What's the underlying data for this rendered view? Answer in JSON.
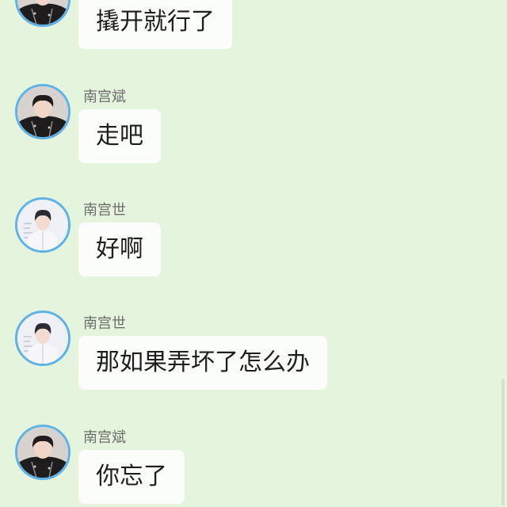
{
  "messages": [
    {
      "sender": "",
      "text": "撬开就行了",
      "avatar": "avatar-dark-jacket"
    },
    {
      "sender": "南宫斌",
      "text": "走吧",
      "avatar": "avatar-dark-jacket"
    },
    {
      "sender": "南宫世",
      "text": "好啊",
      "avatar": "avatar-white-suit"
    },
    {
      "sender": "南宫世",
      "text": "那如果弄坏了怎么办",
      "avatar": "avatar-white-suit"
    },
    {
      "sender": "南宫斌",
      "text": "你忘了",
      "avatar": "avatar-dark-jacket"
    }
  ],
  "colors": {
    "background": "#e5f4dd",
    "bubble": "#fbfdfa",
    "avatar_ring": "#5fb2e6",
    "sender_text": "#6d6d6d"
  }
}
